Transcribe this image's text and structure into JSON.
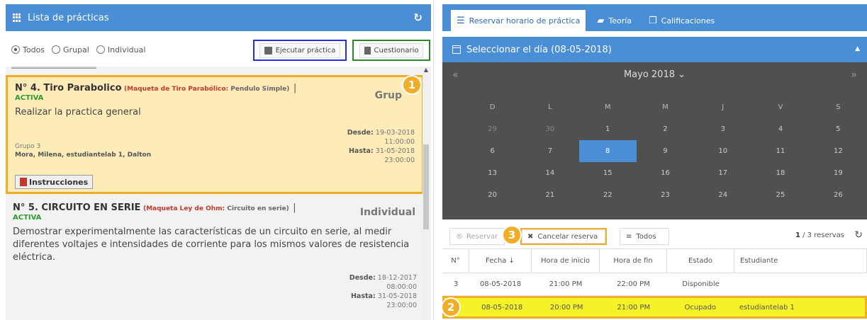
{
  "left_panel": {
    "title": "Lista de prácticas",
    "filters": [
      "Todos",
      "Grupal",
      "Individual"
    ],
    "execute_label": "Ejecutar práctica",
    "quiz_label": "Cuestionario"
  },
  "cards": [
    {
      "title": "N° 4. Tiro Parabolico",
      "kit_label": "(Maqueta de Tiro Parabólico:",
      "kit_value": "Pendulo Simple)",
      "separator": "|",
      "status": "ACTIVA",
      "type": "Grupal",
      "type_shown": "Grup",
      "description": "Realizar la practica general",
      "group": "Grupo 3",
      "members": "Mora, Milena, estudiantelab 1, Dalton",
      "from_label": "Desde:",
      "from_date": "19-03-2018",
      "from_time": "11:00:00",
      "to_label": "Hasta:",
      "to_date": "31-05-2018",
      "to_time": "23:00:00",
      "instructions": "Instrucciones"
    },
    {
      "title": "N° 5. CIRCUITO EN SERIE",
      "kit_label": "(Maqueta Ley de Ohm:",
      "kit_value": "Circuito en serie)",
      "separator": "|",
      "status": "ACTIVA",
      "type": "Individual",
      "description": "Demostrar experimentalmente las características de un circuito en serie, al medir diferentes voltajes e intensidades de corriente para los mismos valores de resistencia eléctrica.",
      "from_label": "Desde:",
      "from_date": "18-12-2017",
      "from_time": "08:00:00",
      "to_label": "Hasta:",
      "to_date": "31-05-2018",
      "to_time": "23:00:00"
    }
  ],
  "badges": [
    "1",
    "2",
    "3"
  ],
  "right_panel": {
    "tabs": [
      "Reservar horario de práctica",
      "Teoría",
      "Calificaciones"
    ],
    "day_header": "Seleccionar el día (08-05-2018)",
    "month": "Mayo 2018",
    "weekdays": [
      "D",
      "L",
      "M",
      "M",
      "J",
      "V",
      "S"
    ],
    "weeks": [
      [
        "29",
        "30",
        "1",
        "2",
        "3",
        "4",
        "5"
      ],
      [
        "6",
        "7",
        "8",
        "9",
        "10",
        "11",
        "12"
      ],
      [
        "13",
        "14",
        "15",
        "16",
        "17",
        "18",
        "19"
      ],
      [
        "20",
        "21",
        "22",
        "23",
        "24",
        "25",
        "26"
      ]
    ],
    "selected_day": "8",
    "toolbar": {
      "reserve": "Reservar",
      "cancel": "Cancelar reserva",
      "all": "Todos",
      "count_bold": "1",
      "count_rest": " / 3 reservas"
    },
    "table": {
      "headers": [
        "N°",
        "Fecha ↓",
        "Hora de inicio",
        "Hora de fin",
        "Estado",
        "Estudiante"
      ],
      "rows": [
        [
          "3",
          "08-05-2018",
          "21:00 PM",
          "22:00 PM",
          "Disponible",
          ""
        ],
        [
          "",
          "08-05-2018",
          "20:00 PM",
          "21:00 PM",
          "Ocupado",
          "estudiantelab 1"
        ]
      ]
    }
  },
  "colors": {
    "primary": "#4a8fd5",
    "highlight": "#f0ad28",
    "active_green": "#2e9a2e",
    "kit_red": "#c0392b"
  }
}
